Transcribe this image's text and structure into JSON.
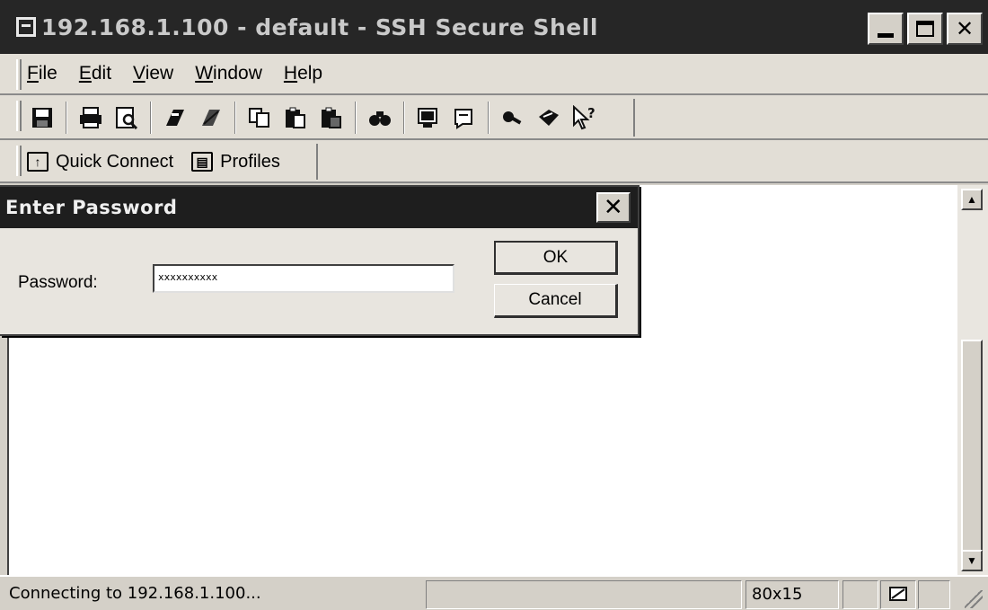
{
  "window": {
    "title": "192.168.1.100 - default - SSH Secure Shell"
  },
  "menu": {
    "items": [
      {
        "label": "File",
        "mnemonic": "F"
      },
      {
        "label": "Edit",
        "mnemonic": "E"
      },
      {
        "label": "View",
        "mnemonic": "V"
      },
      {
        "label": "Window",
        "mnemonic": "W"
      },
      {
        "label": "Help",
        "mnemonic": "H"
      }
    ]
  },
  "toolbar": {
    "icons": [
      "save-icon",
      "print-icon",
      "print-preview-icon",
      "settings-icon",
      "settings-alt-icon",
      "copy-icon",
      "paste-icon",
      "paste-alt-icon",
      "find-icon",
      "new-terminal-icon",
      "new-file-transfer-icon",
      "key-icon",
      "help-topics-icon",
      "whats-this-icon"
    ]
  },
  "quickbar": {
    "quick_connect": "Quick Connect",
    "profiles": "Profiles"
  },
  "dialog": {
    "title": "Enter Password",
    "password_label": "Password:",
    "password_value": "xxxxxxxxxx",
    "ok_label": "OK",
    "cancel_label": "Cancel"
  },
  "status": {
    "message": "Connecting to 192.168.1.100...",
    "size": "80x15"
  }
}
